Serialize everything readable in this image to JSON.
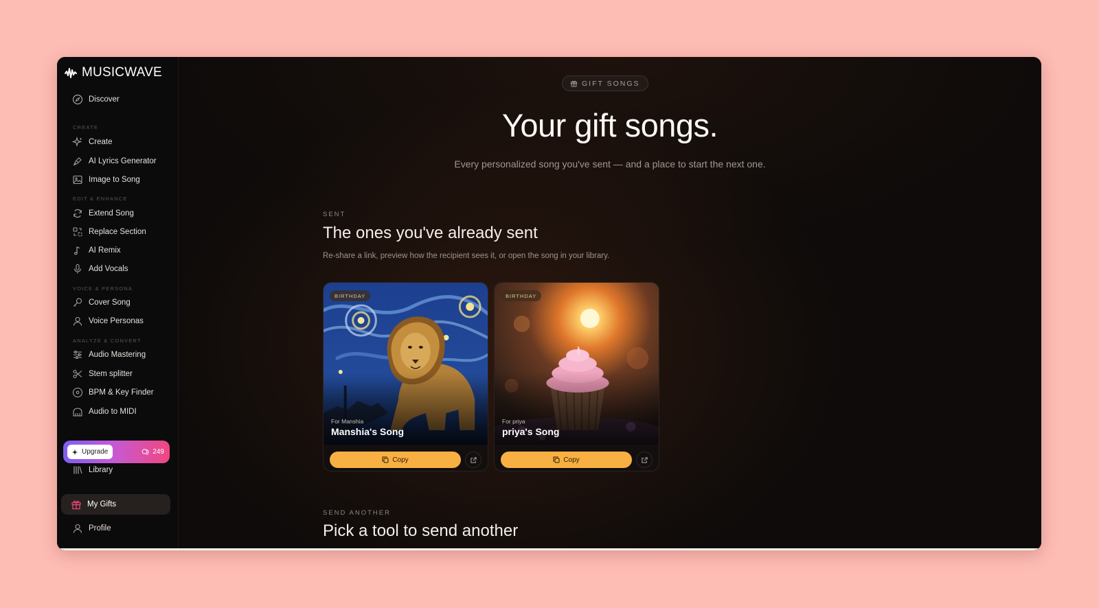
{
  "app": {
    "logo": "MUSICWAVE"
  },
  "sidebar": {
    "discover": "Discover",
    "sections": {
      "create": "CREATE",
      "edit": "EDIT & ENHANCE",
      "voice": "VOICE & PERSONA",
      "analyze": "ANALYZE & CONVERT"
    },
    "items": {
      "create": "Create",
      "lyrics": "AI Lyrics Generator",
      "image_to_song": "Image to Song",
      "extend": "Extend Song",
      "replace": "Replace Section",
      "remix": "AI Remix",
      "vocals": "Add Vocals",
      "cover": "Cover Song",
      "personas": "Voice Personas",
      "mastering": "Audio Mastering",
      "stem": "Stem splitter",
      "bpm": "BPM & Key Finder",
      "midi": "Audio to MIDI",
      "library": "Library",
      "gifts": "My Gifts",
      "profile": "Profile"
    },
    "upgrade_label": "Upgrade",
    "credits": "249"
  },
  "main": {
    "pill": "GIFT SONGS",
    "title": "Your gift songs.",
    "subtitle": "Every personalized song you've sent — and a place to start the next one.",
    "sent_eyebrow": "SENT",
    "sent_title": "The ones you've already sent",
    "sent_desc": "Re-share a link, preview how the recipient sees it, or open the song in your library.",
    "cards": [
      {
        "badge": "BIRTHDAY",
        "for": "For Manshia",
        "name": "Manshia's Song",
        "copy": "Copy"
      },
      {
        "badge": "BIRTHDAY",
        "for": "For priya",
        "name": "priya's Song",
        "copy": "Copy"
      }
    ],
    "another_eyebrow": "SEND ANOTHER",
    "another_title": "Pick a tool to send another"
  },
  "colors": {
    "page_bg": "#fdbcb4",
    "accent": "#f8b042",
    "upgrade_gradient_start": "#7e5df2",
    "upgrade_gradient_end": "#f0477f",
    "gift_icon": "#f0477f"
  }
}
